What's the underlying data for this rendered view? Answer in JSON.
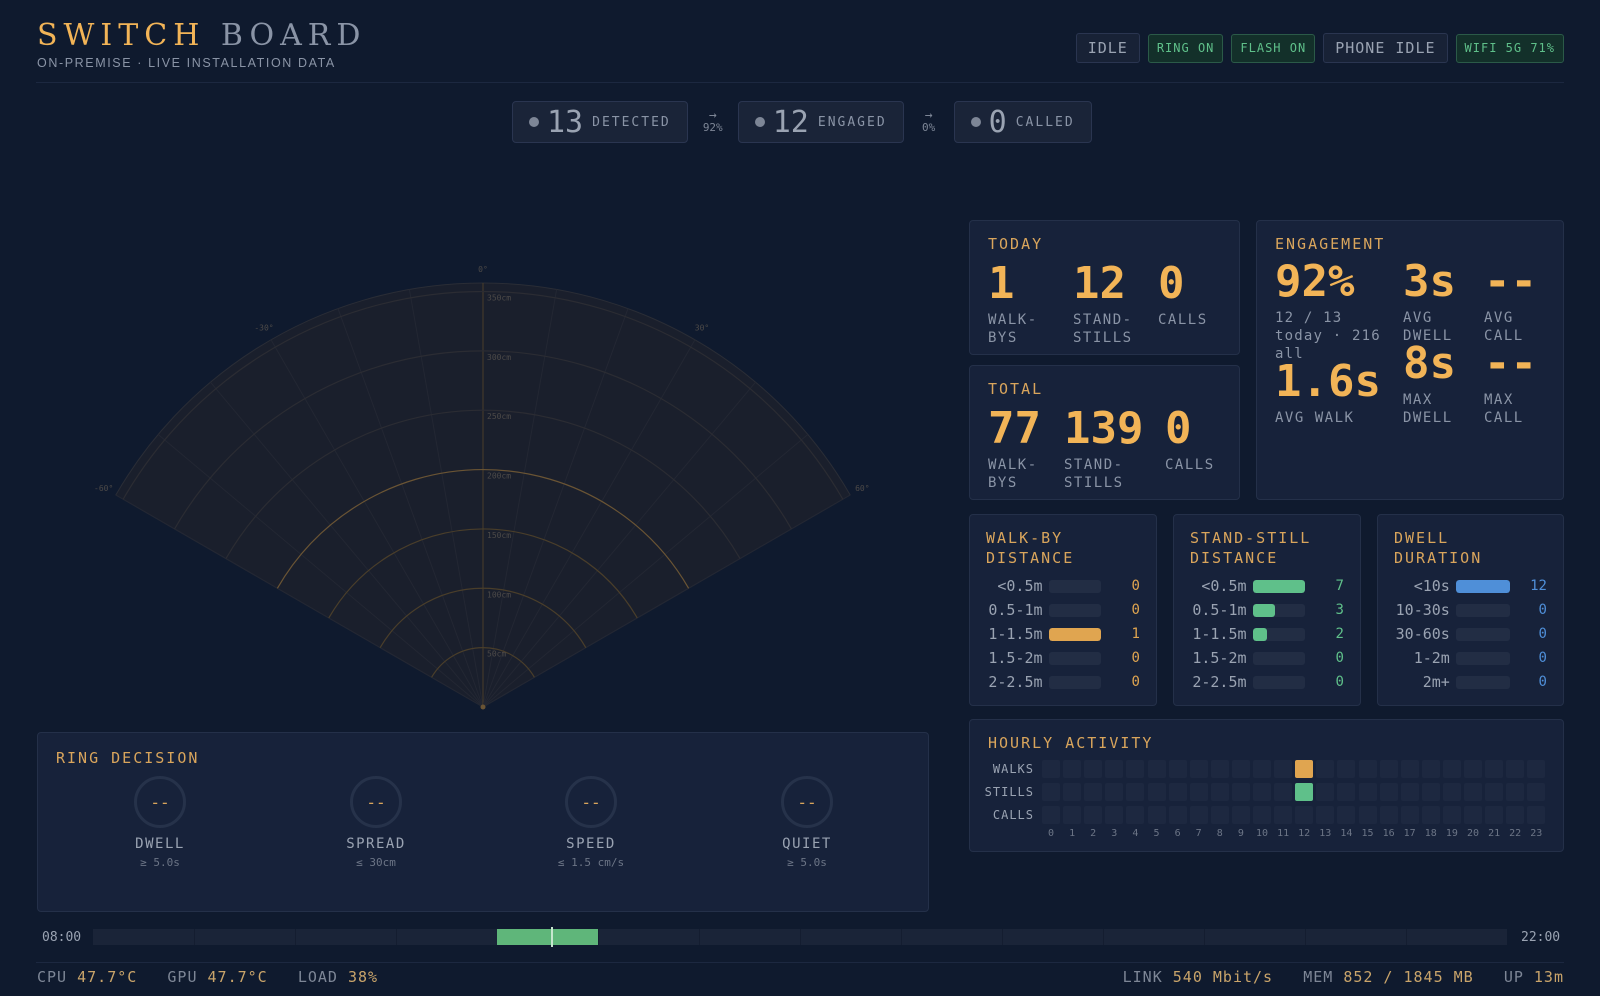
{
  "brand": {
    "title_a": "SWITCH",
    "title_b": "BOARD",
    "subtitle": "ON-PREMISE · LIVE INSTALLATION DATA"
  },
  "chips": [
    "IDLE",
    "RING ON",
    "FLASH ON",
    "PHONE IDLE",
    "WIFI 5G 71%"
  ],
  "funnel": {
    "detected": {
      "value": "13",
      "label": "DETECTED"
    },
    "rate1": "92%",
    "engaged": {
      "value": "12",
      "label": "ENGAGED"
    },
    "rate2": "0%",
    "called": {
      "value": "0",
      "label": "CALLED"
    }
  },
  "radar": {
    "angle_labels": [
      "0°",
      "-30°",
      "30°",
      "-60°",
      "60°"
    ],
    "range_labels": [
      "350cm",
      "300cm",
      "250cm",
      "200cm",
      "150cm",
      "100cm",
      "50cm"
    ]
  },
  "today": {
    "title": "TODAY",
    "stats": [
      {
        "n": "1",
        "l1": "WALK-",
        "l2": "BYS"
      },
      {
        "n": "12",
        "l1": "STAND-",
        "l2": "STILLS"
      },
      {
        "n": "0",
        "l1": "CALLS",
        "l2": ""
      }
    ]
  },
  "total": {
    "title": "TOTAL",
    "stats": [
      {
        "n": "77",
        "l1": "WALK-",
        "l2": "BYS"
      },
      {
        "n": "139",
        "l1": "STAND-",
        "l2": "STILLS"
      },
      {
        "n": "0",
        "l1": "CALLS",
        "l2": ""
      }
    ]
  },
  "engagement": {
    "title": "ENGAGEMENT",
    "pct": "92%",
    "pct_sub1": "12 / 13",
    "pct_sub2": "today · 216",
    "pct_sub3": "all",
    "avg_dwell": {
      "n": "3s",
      "l1": "AVG",
      "l2": "DWELL"
    },
    "avg_call": {
      "n": "--",
      "l1": "AVG",
      "l2": "CALL"
    },
    "avg_walk": {
      "n": "1.6s",
      "l1": "AVG WALK"
    },
    "max_dwell": {
      "n": "8s",
      "l1": "MAX",
      "l2": "DWELL"
    },
    "max_call": {
      "n": "--",
      "l1": "MAX",
      "l2": "CALL"
    }
  },
  "walkby_distance": {
    "title1": "WALK-BY",
    "title2": "DISTANCE",
    "color": "#e0a550",
    "rows": [
      {
        "label": "<0.5m",
        "value": "0",
        "frac": 0
      },
      {
        "label": "0.5-1m",
        "value": "0",
        "frac": 0
      },
      {
        "label": "1-1.5m",
        "value": "1",
        "frac": 1
      },
      {
        "label": "1.5-2m",
        "value": "0",
        "frac": 0
      },
      {
        "label": "2-2.5m",
        "value": "0",
        "frac": 0
      }
    ]
  },
  "standstill_distance": {
    "title1": "STAND-STILL",
    "title2": "DISTANCE",
    "color": "#5fc08a",
    "rows": [
      {
        "label": "<0.5m",
        "value": "7",
        "frac": 1
      },
      {
        "label": "0.5-1m",
        "value": "3",
        "frac": 0.43
      },
      {
        "label": "1-1.5m",
        "value": "2",
        "frac": 0.28
      },
      {
        "label": "1.5-2m",
        "value": "0",
        "frac": 0
      },
      {
        "label": "2-2.5m",
        "value": "0",
        "frac": 0
      }
    ]
  },
  "dwell_duration": {
    "title1": "DWELL",
    "title2": "DURATION",
    "color": "#4f8fd8",
    "rows": [
      {
        "label": "<10s",
        "value": "12",
        "frac": 1
      },
      {
        "label": "10-30s",
        "value": "0",
        "frac": 0
      },
      {
        "label": "30-60s",
        "value": "0",
        "frac": 0
      },
      {
        "label": "1-2m",
        "value": "0",
        "frac": 0
      },
      {
        "label": "2m+",
        "value": "0",
        "frac": 0
      }
    ]
  },
  "hourly": {
    "title": "HOURLY ACTIVITY",
    "rows": [
      "WALKS",
      "STILLS",
      "CALLS"
    ],
    "hours": [
      "0",
      "1",
      "2",
      "3",
      "4",
      "5",
      "6",
      "7",
      "8",
      "9",
      "10",
      "11",
      "12",
      "13",
      "14",
      "15",
      "16",
      "17",
      "18",
      "19",
      "20",
      "21",
      "22",
      "23"
    ],
    "active": [
      {
        "row": 0,
        "hour": 12,
        "color": "#e0a550"
      },
      {
        "row": 1,
        "hour": 12,
        "color": "#5fc08a"
      }
    ]
  },
  "ring_decision": {
    "title": "RING DECISION",
    "gauges": [
      {
        "value": "--",
        "label": "DWELL",
        "sub": "≥ 5.0s"
      },
      {
        "value": "--",
        "label": "SPREAD",
        "sub": "≤ 30cm"
      },
      {
        "value": "--",
        "label": "SPEED",
        "sub": "≤ 1.5 cm/s"
      },
      {
        "value": "--",
        "label": "QUIET",
        "sub": "≥ 5.0s"
      }
    ]
  },
  "timeline": {
    "start": "08:00",
    "end": "22:00",
    "fill_from": 0.286,
    "fill_to": 0.357,
    "marker": 0.324
  },
  "footer": {
    "cpu_label": "CPU",
    "cpu": "47.7°C",
    "gpu_label": "GPU",
    "gpu": "47.7°C",
    "load_label": "LOAD",
    "load": "38%",
    "link_label": "LINK",
    "link": "540 Mbit/s",
    "mem_label": "MEM",
    "mem": "852 / 1845 MB",
    "up_label": "UP",
    "up": "13m"
  }
}
